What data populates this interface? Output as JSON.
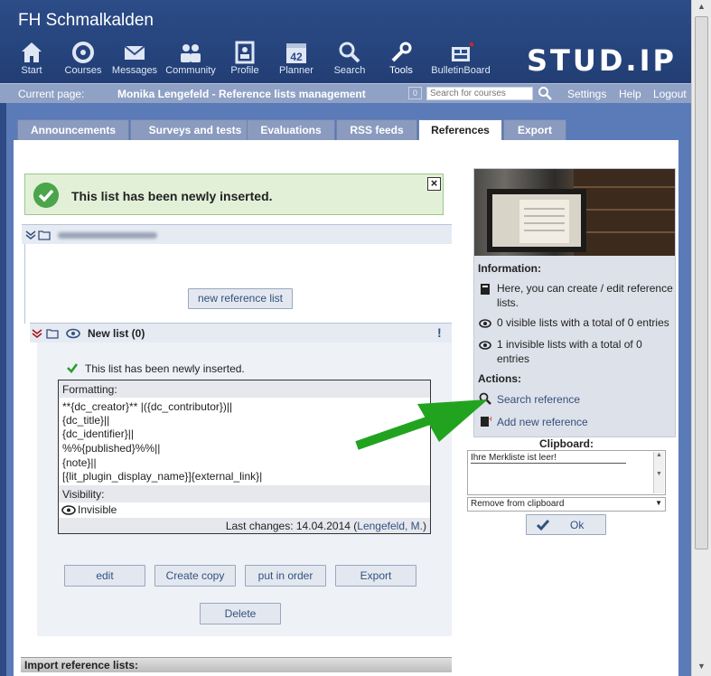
{
  "header": {
    "uni_name": "FH Schmalkalden",
    "logo_text": "STUD.IP",
    "nav": [
      {
        "label": "Start",
        "icon": "home-icon"
      },
      {
        "label": "Courses",
        "icon": "courses-icon"
      },
      {
        "label": "Messages",
        "icon": "envelope-icon"
      },
      {
        "label": "Community",
        "icon": "community-icon"
      },
      {
        "label": "Profile",
        "icon": "profile-icon"
      },
      {
        "label": "Planner",
        "icon": "calendar-icon",
        "badge": "42"
      },
      {
        "label": "Search",
        "icon": "search-icon"
      },
      {
        "label": "Tools",
        "icon": "wrench-icon"
      },
      {
        "label": "BulletinBoard",
        "icon": "bulletin-icon"
      }
    ]
  },
  "crumbbar": {
    "current_label": "Current page:",
    "current_title": "Monika Lengefeld - Reference lists management",
    "count": "0",
    "search_placeholder": "Search for courses",
    "links": [
      "Settings",
      "Help",
      "Logout"
    ]
  },
  "tabs": [
    "Announcements",
    "Surveys and tests",
    "Evaluations",
    "RSS feeds",
    "References",
    "Export"
  ],
  "active_tab": "References",
  "message": "This list has been newly inserted.",
  "list1": {
    "new_button": "new reference list"
  },
  "list2": {
    "title": "New list (0)",
    "inner_message": "This list has been newly inserted.",
    "formatting_label": "Formatting:",
    "formatting_lines": [
      "**{dc_creator}** |({dc_contributor})||",
      "{dc_title}||",
      "{dc_identifier}||",
      "%%{published}%%||",
      "{note}||",
      "[{lit_plugin_display_name}]{external_link}|"
    ],
    "visibility_label": "Visibility:",
    "visibility_value": "Invisible",
    "last_changes_prefix": "Last changes: 14.04.2014 (",
    "last_changes_author": "Lengefeld, M.",
    "last_changes_suffix": ")",
    "buttons": [
      "edit",
      "Create copy",
      "put in order",
      "Export"
    ],
    "delete_button": "Delete"
  },
  "sidebar": {
    "info_title": "Information:",
    "info_items": [
      "Here, you can create / edit reference lists.",
      "0 visible lists with a total of 0 entries",
      "1 invisible lists with a total of 0 entries"
    ],
    "actions_title": "Actions:",
    "actions": [
      "Search reference",
      "Add new reference"
    ]
  },
  "clipboard": {
    "label": "Clipboard:",
    "content": "Ihre Merkliste ist leer!",
    "select_value": "Remove from clipboard",
    "ok_button": "Ok"
  },
  "import_label": "Import reference lists:",
  "colors": {
    "accent": "#2c4c88",
    "annotation_arrow": "#22a31f"
  }
}
